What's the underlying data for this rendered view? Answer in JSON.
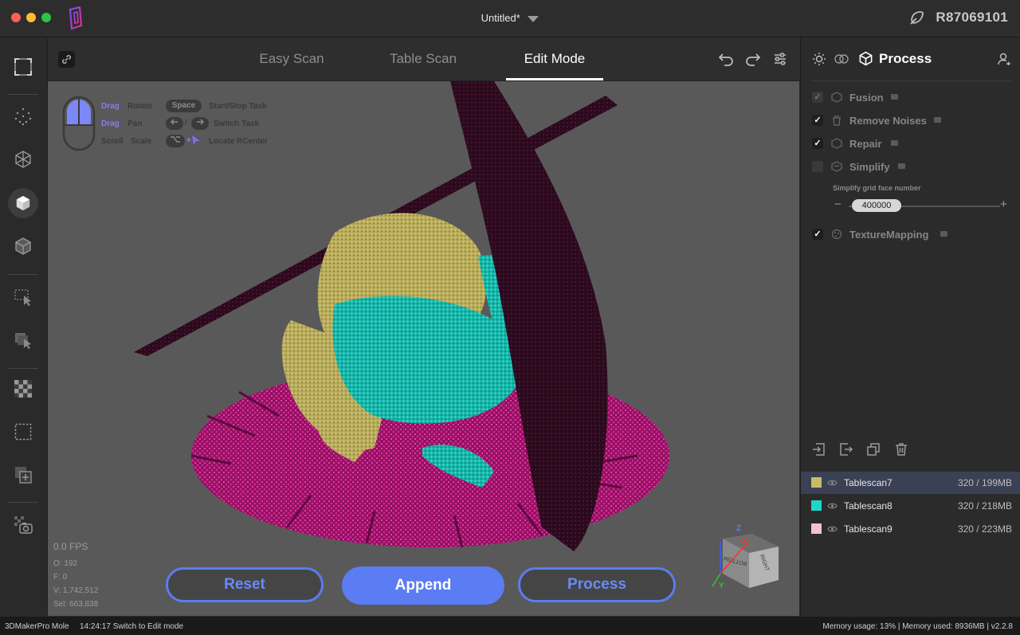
{
  "window": {
    "title": "Untitled*",
    "device_id": "R87069101"
  },
  "tabs": [
    {
      "label": "Easy Scan"
    },
    {
      "label": "Table Scan"
    },
    {
      "label": "Edit Mode",
      "active": true
    }
  ],
  "viewport": {
    "hints": {
      "drag1": "Drag",
      "rotate": "Rotate",
      "drag2": "Drag",
      "pan": "Pan",
      "scroll": "Scroll",
      "scale": "Scale",
      "space_key": "Space",
      "start_stop": "Start/Stop Task",
      "switch_task": "Switch Task",
      "locate": "Locate RCenter",
      "slash": "/",
      "plus": "+"
    },
    "stats": {
      "fps": "0.0 FPS",
      "o": "O: 192",
      "f": "F: 0",
      "v": "V: 1,742,512",
      "sel": "Sel: 663,838"
    },
    "gizmo": {
      "z": "Z",
      "x": "X",
      "y": "Y",
      "top_face": "RIGHT",
      "front_face": "BOTTOM"
    },
    "buttons": {
      "reset": "Reset",
      "append": "Append",
      "process": "Process"
    }
  },
  "right_panel": {
    "title": "Process",
    "steps": [
      {
        "label": "Fusion",
        "checked": true,
        "enabled": false
      },
      {
        "label": "Remove Noises",
        "checked": true,
        "enabled": true
      },
      {
        "label": "Repair",
        "checked": true,
        "enabled": true
      },
      {
        "label": "Simplify",
        "checked": false,
        "enabled": true
      },
      {
        "label": "TextureMapping",
        "checked": true,
        "enabled": true
      }
    ],
    "simplify": {
      "label": "Simplify grid face number",
      "value": "400000",
      "minus": "−",
      "plus": "+"
    },
    "scans": [
      {
        "name": "Tablescan7",
        "size": "320 / 199MB",
        "color": "#c9bb66",
        "selected": true
      },
      {
        "name": "Tablescan8",
        "size": "320 / 218MB",
        "color": "#1fd6c6",
        "selected": false
      },
      {
        "name": "Tablescan9",
        "size": "320 / 223MB",
        "color": "#f2c1cf",
        "selected": false
      }
    ]
  },
  "statusbar": {
    "app": "3DMakerPro Mole",
    "message": "14:24:17 Switch to Edit mode",
    "memory": "Memory usage: 13% | Memory used: 8936MB | v2.2.8"
  },
  "colors": {
    "accent": "#5b7cf2",
    "panel_bg": "#2b2b2b",
    "viewport_bg": "#595959",
    "magenta": "#b3157a",
    "dark_plum": "#2c0a1e",
    "olive": "#c9bb66",
    "cyan": "#1fd6c6"
  }
}
